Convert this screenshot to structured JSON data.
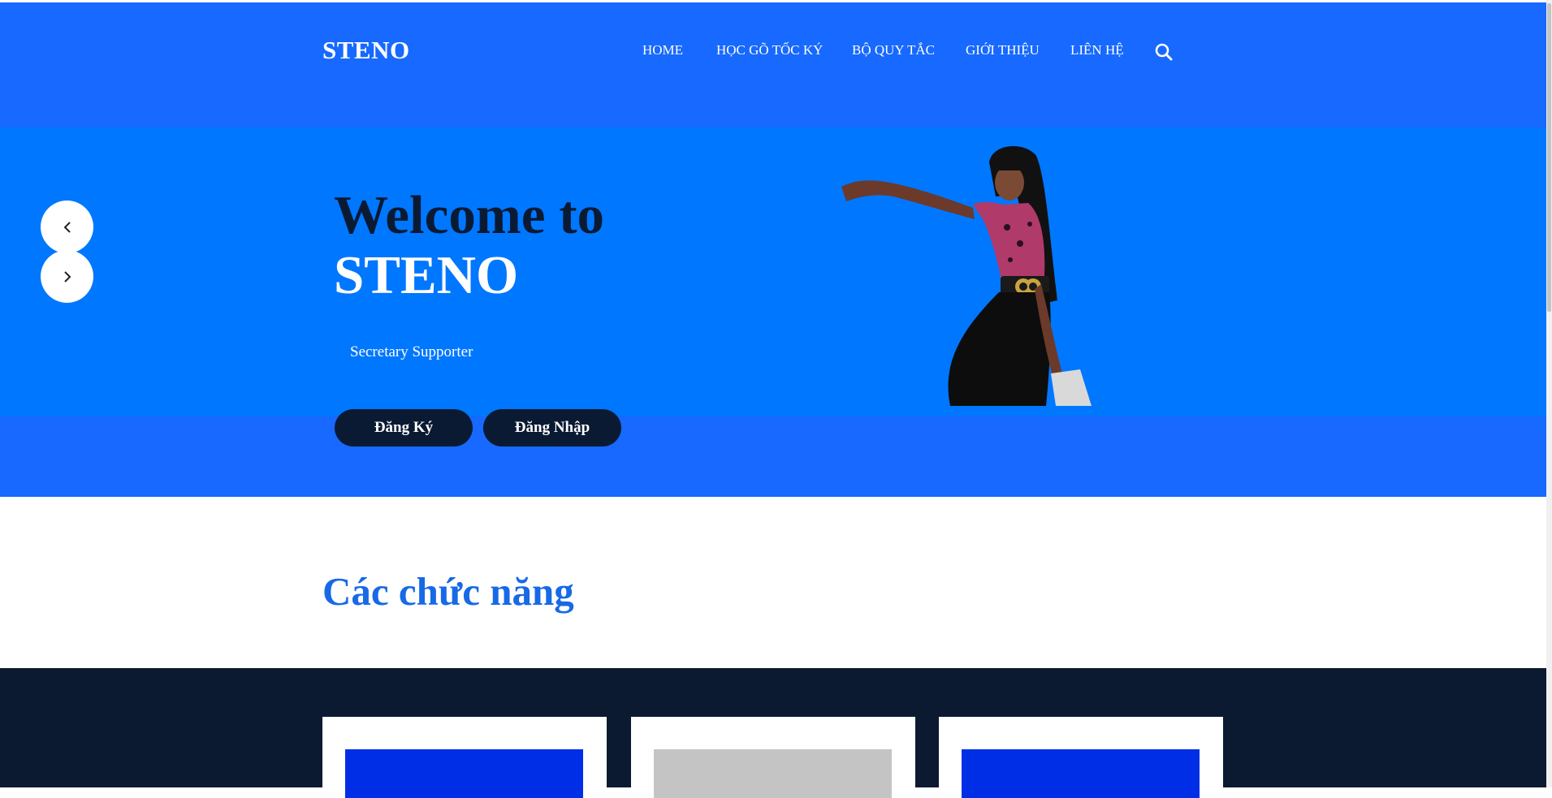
{
  "brand": {
    "logo": "STENO"
  },
  "nav": {
    "items": [
      {
        "label": "HOME"
      },
      {
        "label": "HỌC GÕ TỐC KÝ"
      },
      {
        "label": "BỘ QUY TẮC"
      },
      {
        "label": "GIỚI THIỆU"
      },
      {
        "label": "LIÊN HỆ"
      }
    ],
    "search_icon": "search-icon"
  },
  "hero": {
    "title_line1": "Welcome to",
    "title_line2": "STENO",
    "subtitle": "Secretary Supporter",
    "register_label": "Đăng Ký",
    "login_label": "Đăng Nhập",
    "prev_icon": "chevron-left-icon",
    "next_icon": "chevron-right-icon",
    "image": "woman-pointing-illustration"
  },
  "features": {
    "title": "Các chức năng",
    "cards": [
      {
        "thumb_color": "#002ee6"
      },
      {
        "thumb_color": "#c4c4c4"
      },
      {
        "thumb_color": "#002ee6"
      }
    ]
  },
  "colors": {
    "header_bg": "#1769ff",
    "hero_bg": "#0077ff",
    "dark_text": "#0b1a33",
    "section_title": "#1769e6",
    "dark_band": "#0b1a30"
  }
}
